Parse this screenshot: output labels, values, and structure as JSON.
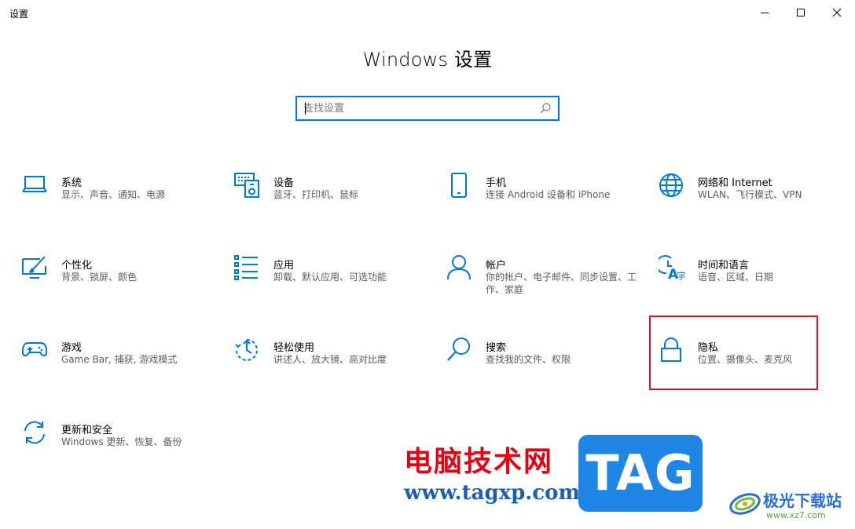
{
  "window": {
    "title": "设置",
    "minimize_icon": "minimize-icon",
    "maximize_icon": "maximize-icon",
    "close_icon": "close-icon"
  },
  "heading": "Windows 设置",
  "search": {
    "placeholder": "查找设置",
    "value": "",
    "icon": "search-icon"
  },
  "accent_color": "#0078d7",
  "categories": [
    {
      "icon": "laptop-icon",
      "title": "系统",
      "desc": "显示、声音、通知、电源"
    },
    {
      "icon": "devices-icon",
      "title": "设备",
      "desc": "蓝牙、打印机、鼠标"
    },
    {
      "icon": "phone-icon",
      "title": "手机",
      "desc": "连接 Android 设备和 iPhone"
    },
    {
      "icon": "globe-icon",
      "title": "网络和 Internet",
      "desc": "WLAN、飞行模式、VPN"
    },
    {
      "icon": "personalization-icon",
      "title": "个性化",
      "desc": "背景、锁屏、颜色"
    },
    {
      "icon": "apps-icon",
      "title": "应用",
      "desc": "卸载、默认应用、可选功能"
    },
    {
      "icon": "person-icon",
      "title": "帐户",
      "desc": "你的帐户、电子邮件、同步设置、工作、家庭"
    },
    {
      "icon": "time-language-icon",
      "title": "时间和语言",
      "desc": "语音、区域、日期"
    },
    {
      "icon": "gamepad-icon",
      "title": "游戏",
      "desc": "Game Bar, 捕获, 游戏模式"
    },
    {
      "icon": "ease-of-access-icon",
      "title": "轻松使用",
      "desc": "讲述人、放大镜、高对比度"
    },
    {
      "icon": "search-icon",
      "title": "搜索",
      "desc": "查找我的文件、权限"
    },
    {
      "icon": "lock-icon",
      "title": "隐私",
      "desc": "位置、摄像头、麦克风"
    },
    {
      "icon": "update-icon",
      "title": "更新和安全",
      "desc": "Windows 更新、恢复、备份"
    }
  ],
  "highlight": {
    "target": "隐私",
    "color": "#e0121b"
  },
  "watermark": {
    "site_name": "电脑技术网",
    "site_url": "www.tagxp.com",
    "badge": "TAG",
    "badge_color": "#1f86e6",
    "partner_name": "极光下载站",
    "partner_url": "www.xz7.com"
  }
}
